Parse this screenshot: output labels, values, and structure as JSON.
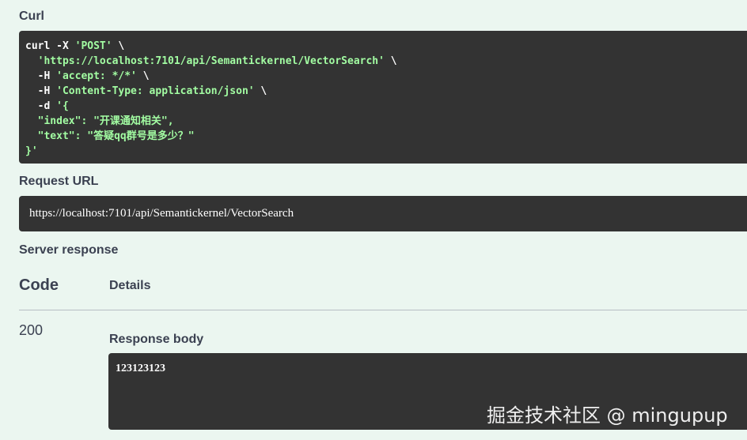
{
  "curl": {
    "title": "Curl",
    "lines": [
      [
        {
          "t": "curl -X ",
          "c": "cmd"
        },
        {
          "t": "'POST'",
          "c": "str"
        },
        {
          "t": " \\",
          "c": "cmd"
        }
      ],
      [
        {
          "t": "  ",
          "c": "cmd"
        },
        {
          "t": "'https://localhost:7101/api/Semantickernel/VectorSearch'",
          "c": "str"
        },
        {
          "t": " \\",
          "c": "cmd"
        }
      ],
      [
        {
          "t": "  -H ",
          "c": "cmd"
        },
        {
          "t": "'accept: */*'",
          "c": "str"
        },
        {
          "t": " \\",
          "c": "cmd"
        }
      ],
      [
        {
          "t": "  -H ",
          "c": "cmd"
        },
        {
          "t": "'Content-Type: application/json'",
          "c": "str"
        },
        {
          "t": " \\",
          "c": "cmd"
        }
      ],
      [
        {
          "t": "  -d ",
          "c": "cmd"
        },
        {
          "t": "'{",
          "c": "str"
        }
      ],
      [
        {
          "t": "  \"index\": \"开课通知相关\",",
          "c": "str"
        }
      ],
      [
        {
          "t": "  \"text\": \"答疑qq群号是多少？\"",
          "c": "str"
        }
      ],
      [
        {
          "t": "}'",
          "c": "str"
        }
      ]
    ]
  },
  "request_url": {
    "title": "Request URL",
    "value": "https://localhost:7101/api/Semantickernel/VectorSearch"
  },
  "server_response": {
    "title": "Server response",
    "code_header": "Code",
    "details_header": "Details",
    "status_code": "200",
    "response_body_title": "Response body",
    "response_body": "123123123"
  },
  "watermark": "掘金技术社区 @ mingupup",
  "colors": {
    "background": "#ebf6f0",
    "code_bg": "#333333",
    "string": "#a2fca2",
    "text": "#3b4151"
  }
}
